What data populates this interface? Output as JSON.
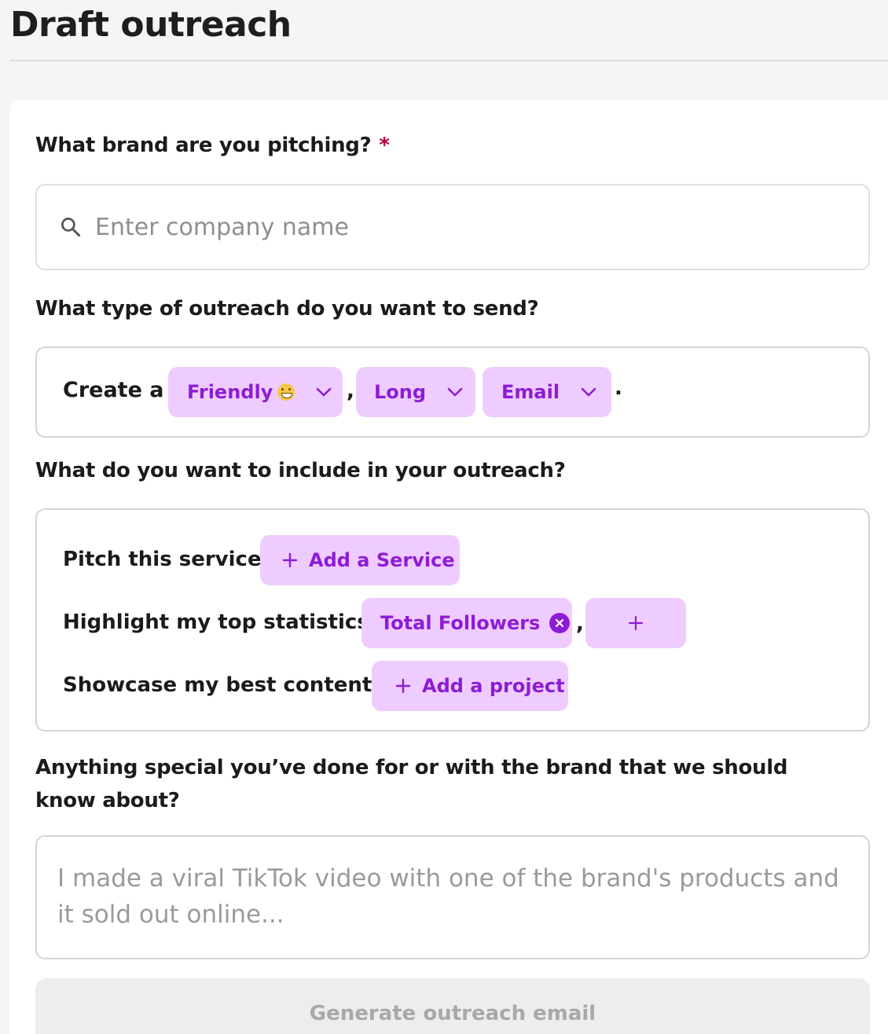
{
  "header": {
    "title": "Draft outreach"
  },
  "brand_question": {
    "label": "What brand are you pitching?",
    "required_mark": "*",
    "placeholder": "Enter company name",
    "value": ""
  },
  "outreach_type": {
    "label": "What type of outreach do you want to send?",
    "prefix": "Create a",
    "tone": {
      "label": "Friendly",
      "emoji_icon": "grinning-face-emoji"
    },
    "separator": ",",
    "length": "Long",
    "format": "Email",
    "terminator": "."
  },
  "include": {
    "label": "What do you want to include in your outreach?",
    "service": {
      "label": "Pitch this service:",
      "add_button": "Add a Service"
    },
    "statistics": {
      "label": "Highlight my top statistics:",
      "chips": [
        "Total Followers"
      ],
      "separator": ",",
      "add_button_icon": "plus-icon"
    },
    "content": {
      "label": "Showcase my best content:",
      "add_button": "Add a project"
    }
  },
  "special": {
    "label": "Anything special you’ve done for or with the brand that we should know about?",
    "placeholder": "I made a viral TikTok video with one of the brand's products and it sold out online..."
  },
  "submit": {
    "label": "Generate outreach email"
  },
  "colors": {
    "pill_bg": "#efccff",
    "pill_text": "#8c1cd6",
    "required": "#b3003b",
    "button_disabled_bg": "#ededed"
  }
}
